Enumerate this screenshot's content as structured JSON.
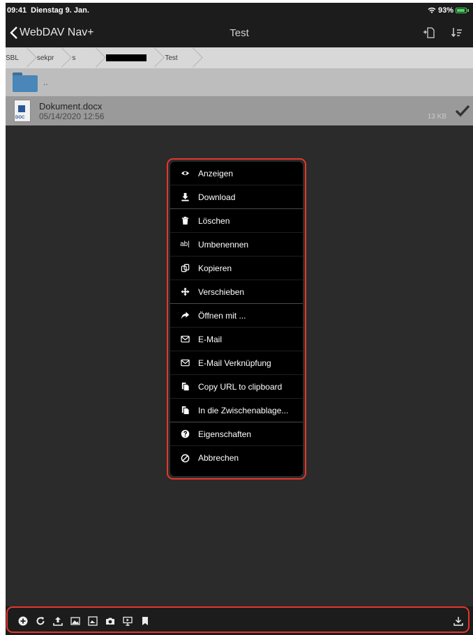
{
  "status": {
    "time": "09:41",
    "date": "Dienstag 9. Jan.",
    "battery": "93%"
  },
  "nav": {
    "back_label": "WebDAV Nav+",
    "title": "Test"
  },
  "breadcrumb": {
    "items": [
      "SBL",
      "sekpr",
      "s",
      "Test"
    ]
  },
  "folder_up": {
    "label": ".."
  },
  "file": {
    "name": "Dokument.docx",
    "date": "05/14/2020 12:56",
    "size": "13 KB",
    "icon_label": "DOC"
  },
  "context_menu": {
    "items": [
      {
        "label": "Anzeigen",
        "icon": "eye-icon"
      },
      {
        "label": "Download",
        "icon": "download-icon"
      },
      {
        "label": "Löschen",
        "icon": "trash-icon"
      },
      {
        "label": "Umbenennen",
        "icon": "rename-icon",
        "icon_text": "ab|"
      },
      {
        "label": "Kopieren",
        "icon": "copy-icon"
      },
      {
        "label": "Verschieben",
        "icon": "move-icon"
      },
      {
        "label": "Öffnen mit ...",
        "icon": "share-arrow-icon"
      },
      {
        "label": "E-Mail",
        "icon": "mail-icon"
      },
      {
        "label": "E-Mail Verknüpfung",
        "icon": "mail-link-icon"
      },
      {
        "label": "Copy URL to clipboard",
        "icon": "clipboard-icon"
      },
      {
        "label": "In die Zwischenablage...",
        "icon": "clipboard-icon"
      },
      {
        "label": "Eigenschaften",
        "icon": "info-icon"
      },
      {
        "label": "Abbrechen",
        "icon": "cancel-icon"
      }
    ]
  },
  "colors": {
    "highlight_outline": "#e5362b",
    "folder": "#4a86b8",
    "battery": "#4cd964"
  }
}
